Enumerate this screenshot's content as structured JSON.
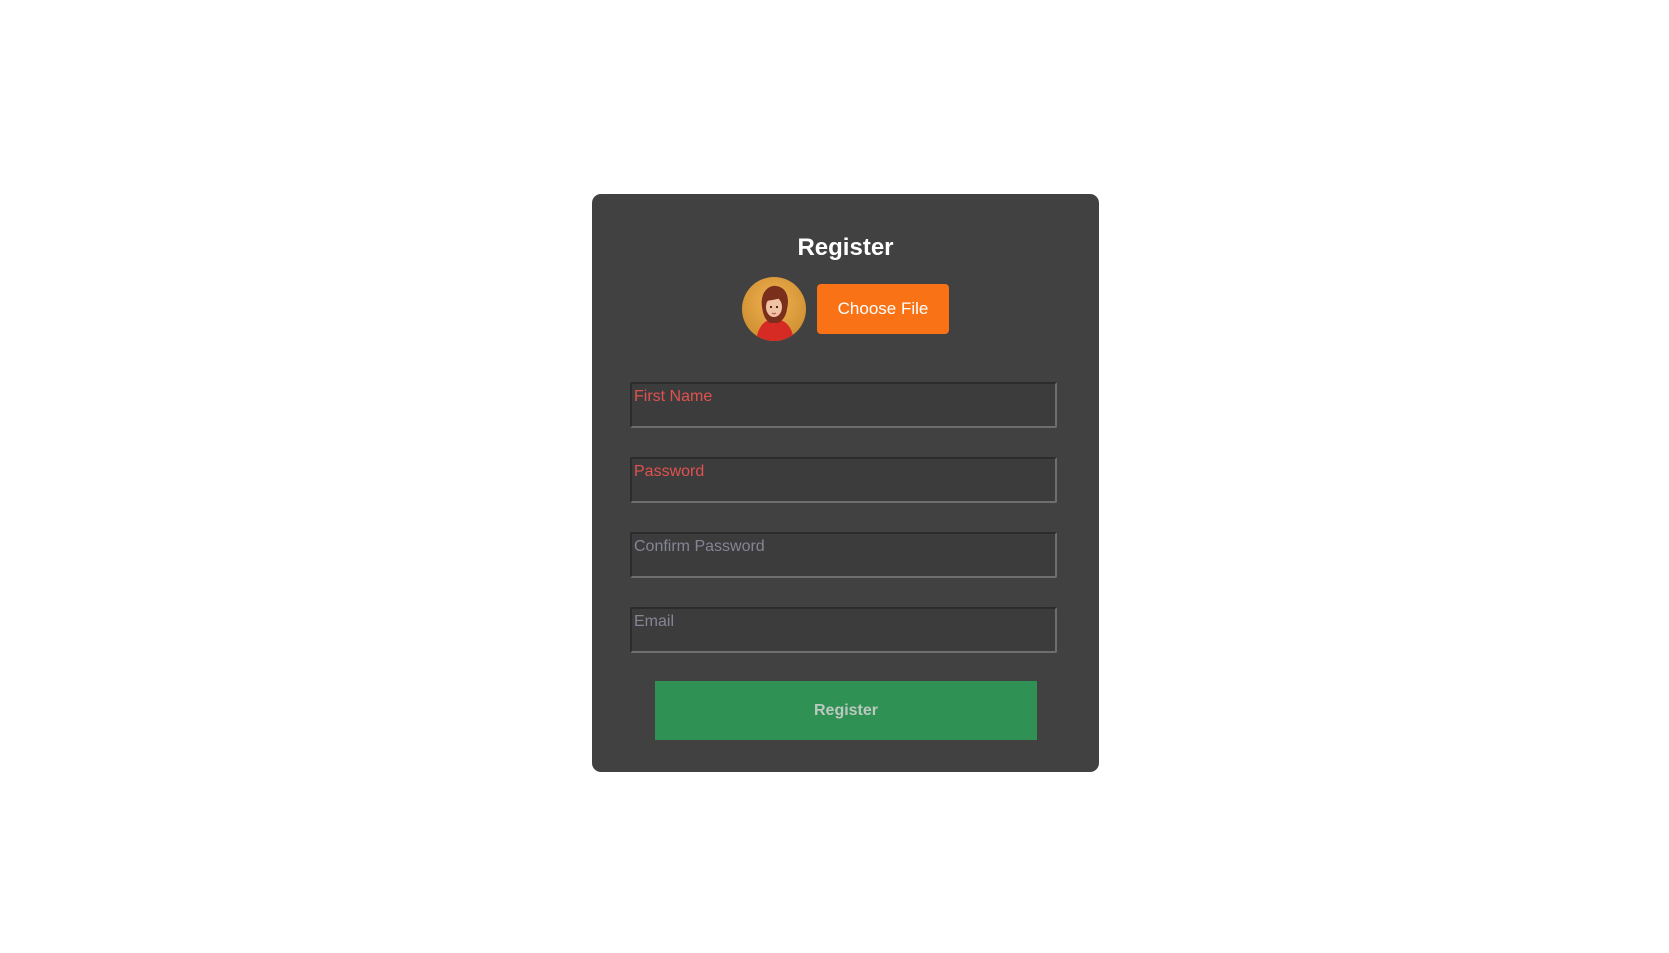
{
  "form": {
    "title": "Register",
    "avatar_icon": "profile-photo",
    "choose_file_label": "Choose File",
    "fields": [
      {
        "placeholder": "First Name",
        "value": "",
        "state": "error"
      },
      {
        "placeholder": "Password",
        "value": "",
        "state": "error"
      },
      {
        "placeholder": "Confirm Password",
        "value": "",
        "state": "normal"
      },
      {
        "placeholder": "Email",
        "value": "",
        "state": "normal"
      }
    ],
    "submit_label": "Register"
  },
  "colors": {
    "page_bg": "#ffffff",
    "card_bg": "#414141",
    "accent_orange": "#f97316",
    "submit_green": "#2f9154",
    "error_text": "#e0524f",
    "placeholder_text": "#858596"
  }
}
